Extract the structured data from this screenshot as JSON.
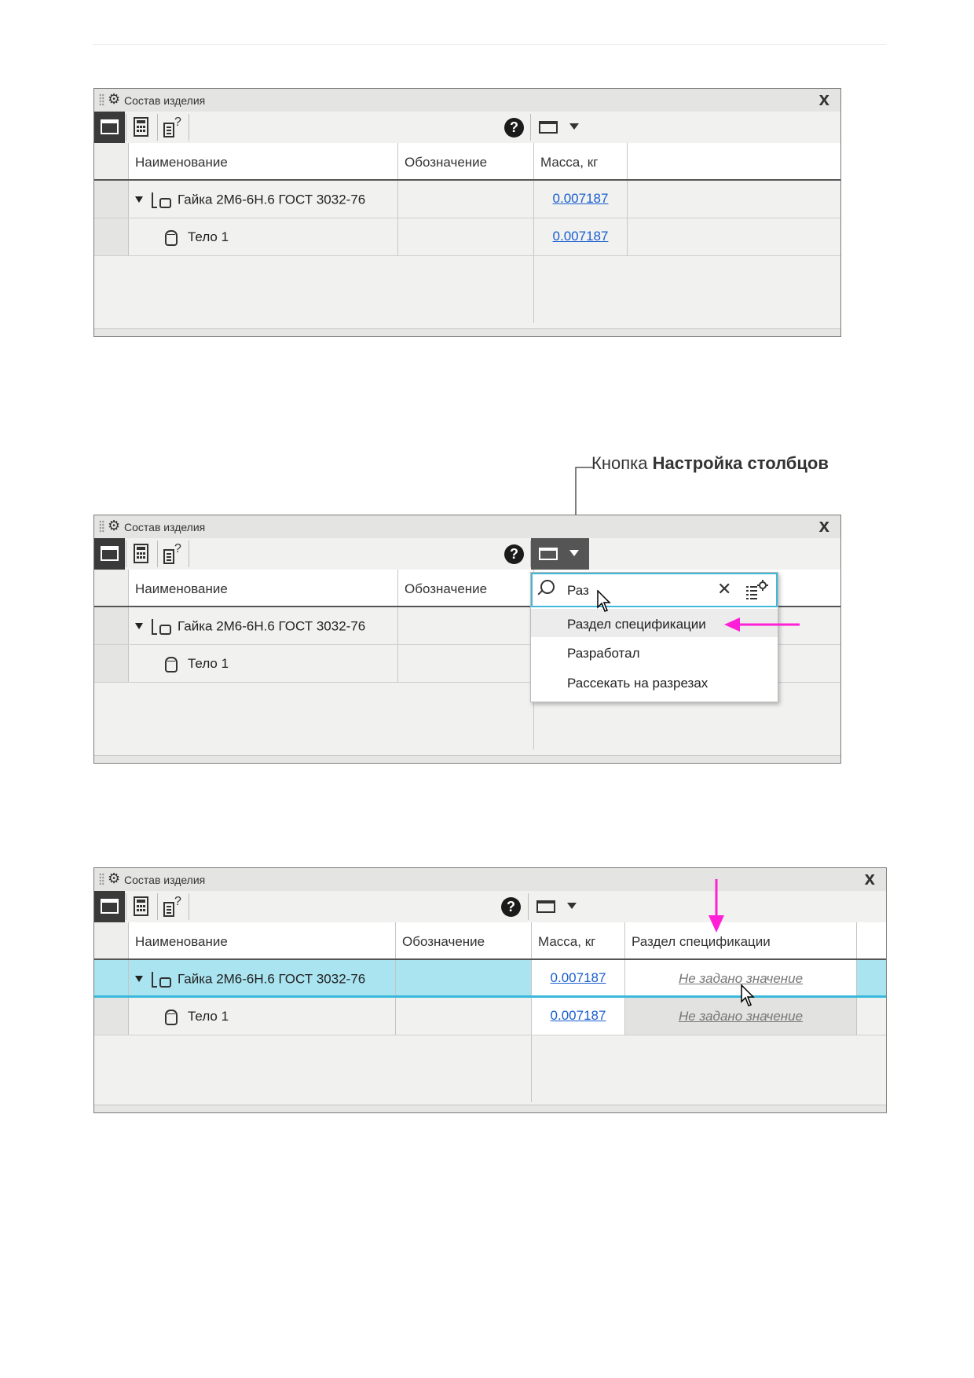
{
  "panel": {
    "title": "Состав изделия",
    "close": "x",
    "help": "?"
  },
  "columns": {
    "name": "Наименование",
    "designation": "Обозначение",
    "mass": "Масса, кг",
    "spec_section": "Раздел спецификации"
  },
  "rows": [
    {
      "name": "Гайка 2М6-6Н.6 ГОСТ 3032-76",
      "mass": "0.007187",
      "icon": "assembly-icon"
    },
    {
      "name": "Тело 1",
      "mass": "0.007187",
      "icon": "body-icon"
    }
  ],
  "callout": {
    "prefix": "Кнопка ",
    "bold": "Настройка столбцов"
  },
  "dropdown": {
    "search_value": "Раз",
    "items": [
      "Раздел спецификации",
      "Разработал",
      "Рассекать на разрезах"
    ]
  },
  "not_set": "Не задано значение",
  "colors": {
    "accent": "#3ab9dc",
    "highlight_row": "#a9e4f0",
    "arrow": "#ff1fd6",
    "link": "#1a5fd0"
  }
}
